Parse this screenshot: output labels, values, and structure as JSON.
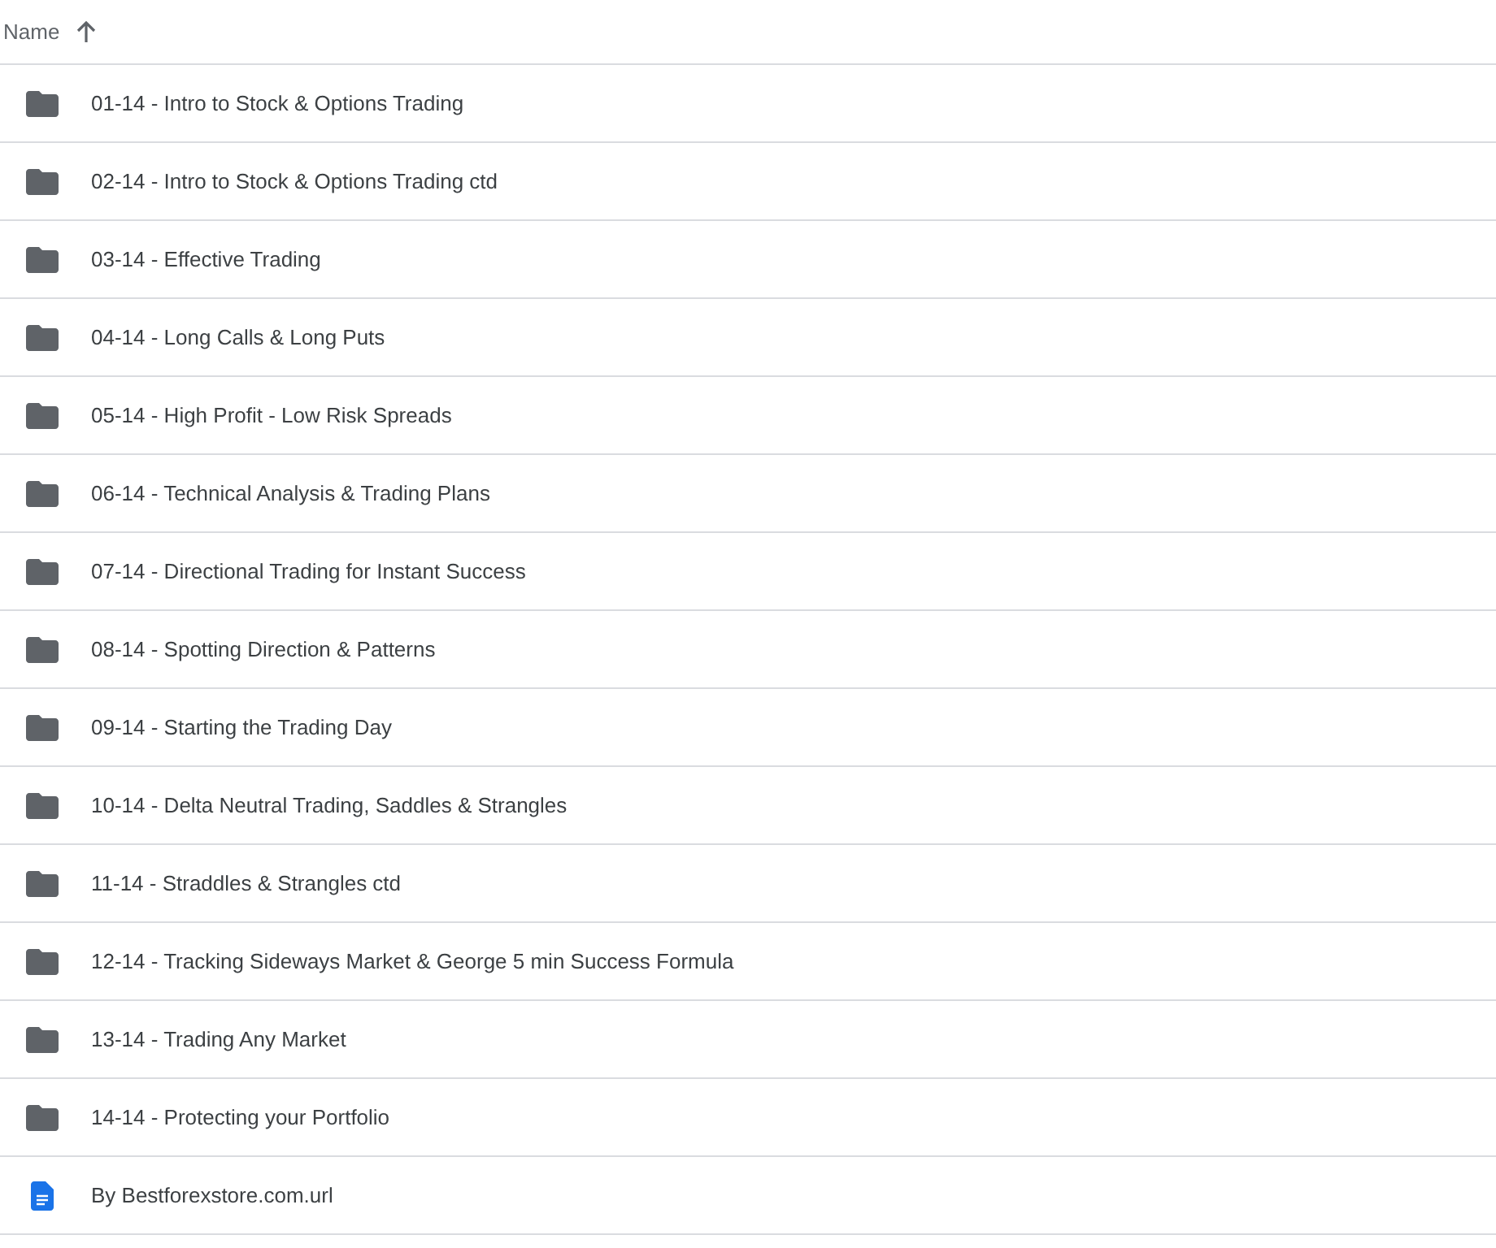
{
  "header": {
    "label": "Name",
    "sort_ascending": true
  },
  "items": [
    {
      "kind": "folder",
      "name": "01-14 - Intro to Stock & Options Trading"
    },
    {
      "kind": "folder",
      "name": "02-14 - Intro to Stock & Options Trading ctd"
    },
    {
      "kind": "folder",
      "name": "03-14 - Effective Trading"
    },
    {
      "kind": "folder",
      "name": "04-14 - Long Calls & Long Puts"
    },
    {
      "kind": "folder",
      "name": "05-14 - High Profit - Low Risk Spreads"
    },
    {
      "kind": "folder",
      "name": "06-14 - Technical Analysis & Trading Plans"
    },
    {
      "kind": "folder",
      "name": "07-14 - Directional Trading for Instant Success"
    },
    {
      "kind": "folder",
      "name": "08-14 - Spotting Direction & Patterns"
    },
    {
      "kind": "folder",
      "name": "09-14 - Starting the Trading Day"
    },
    {
      "kind": "folder",
      "name": "10-14 - Delta Neutral Trading, Saddles & Strangles"
    },
    {
      "kind": "folder",
      "name": "11-14 - Straddles & Strangles ctd"
    },
    {
      "kind": "folder",
      "name": "12-14 - Tracking Sideways Market & George 5 min Success Formula"
    },
    {
      "kind": "folder",
      "name": "13-14 - Trading Any Market"
    },
    {
      "kind": "folder",
      "name": "14-14 - Protecting your Portfolio"
    },
    {
      "kind": "document",
      "name": "By Bestforexstore.com.url"
    }
  ]
}
